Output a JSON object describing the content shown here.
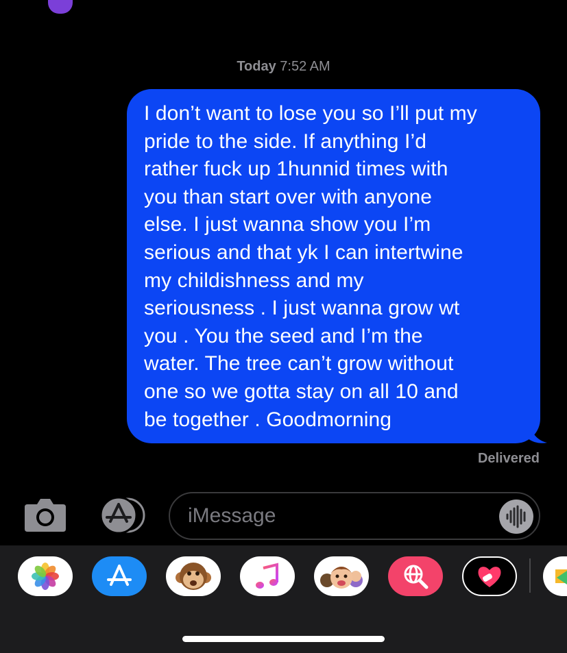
{
  "conversation": {
    "timestamp_day": "Today",
    "timestamp_time": "7:52 AM",
    "message_text": "I don’t want to lose you so I’ll put my pride to the side. If anything I’d rather fuck up 1hunnid times with you than start over with anyone else. I just wanna show you I’m serious and that yk I can intertwine my childishness and my seriousness . I just wanna grow wt you . You the seed and I’m the water. The tree can’t grow without one so we gotta stay on all 10 and be together . Goodmorning",
    "message_lines": [
      "I don’t want to lose you so I’ll put my",
      "pride to the side. If anything I’d",
      "rather fuck up 1hunnid times with",
      "you than start over with anyone",
      "else. I just wanna show you I’m",
      "serious and that yk I can intertwine",
      "my childishness and my",
      "seriousness . I just wanna grow wt",
      "you . You the seed and I’m the",
      "water. The tree can’t grow without",
      "one so we gotta stay on all 10 and",
      "be together . Goodmorning"
    ],
    "delivery_status": "Delivered",
    "bubble_color": "#0c46f4"
  },
  "composer": {
    "placeholder": "iMessage",
    "camera_icon": "camera-icon",
    "apps_icon": "app-store-icon",
    "audio_icon": "waveform-icon"
  },
  "app_tray": {
    "apps": [
      {
        "name": "photos-app",
        "icon": "photos-flower-icon"
      },
      {
        "name": "app-store-app",
        "icon": "app-store-icon"
      },
      {
        "name": "animoji-app",
        "icon": "monkey-face-icon"
      },
      {
        "name": "music-app",
        "icon": "music-note-icon"
      },
      {
        "name": "memoji-stickers-app",
        "icon": "memoji-faces-icon"
      },
      {
        "name": "images-search-app",
        "icon": "globe-search-icon"
      },
      {
        "name": "digital-touch-app",
        "icon": "heart-touch-icon"
      },
      {
        "name": "more-apps",
        "icon": "partial-app-icon"
      }
    ]
  }
}
